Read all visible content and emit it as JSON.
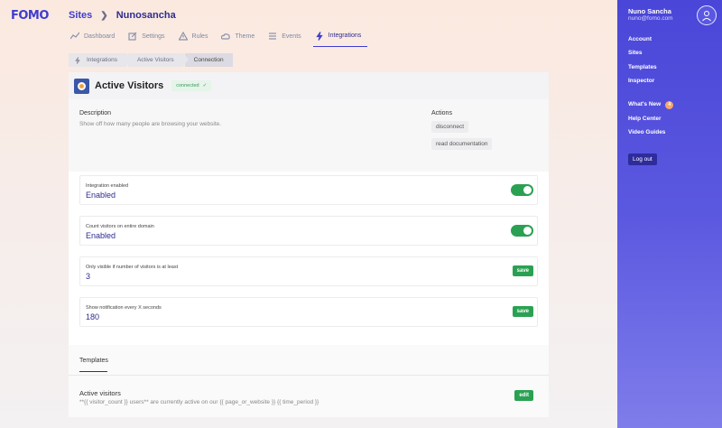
{
  "brand": {
    "logo": "FOMO"
  },
  "header": {
    "breadcrumb": [
      "Sites",
      "Nunosancha"
    ],
    "tabs": [
      {
        "label": "Dashboard",
        "icon": "chart-line-icon"
      },
      {
        "label": "Settings",
        "icon": "edit-icon"
      },
      {
        "label": "Rules",
        "icon": "warning-icon"
      },
      {
        "label": "Theme",
        "icon": "cloud-icon"
      },
      {
        "label": "Events",
        "icon": "list-icon"
      },
      {
        "label": "Integrations",
        "icon": "bolt-icon",
        "active": true
      }
    ]
  },
  "steps": [
    "Integrations",
    "Active Visitors",
    "Connection"
  ],
  "card": {
    "title": "Active Visitors",
    "status": "connected",
    "description_label": "Description",
    "description": "Show off how many people are browsing your website.",
    "actions_label": "Actions",
    "actions": [
      "disconnect",
      "read documentation"
    ]
  },
  "fields": [
    {
      "label": "Integration enabled",
      "value": "Enabled",
      "control": "toggle"
    },
    {
      "label": "Count visitors on entire domain",
      "value": "Enabled",
      "control": "toggle"
    },
    {
      "label": "Only visible if number of visitors is at least",
      "value": "3",
      "control": "save"
    },
    {
      "label": "Show notification every X seconds",
      "value": "180",
      "control": "save"
    }
  ],
  "buttons": {
    "save": "save",
    "edit": "edit"
  },
  "templates": {
    "tab": "Templates",
    "name": "Active visitors",
    "text": "**{{ visitor_count }} users** are currently active on our {{ page_or_website }} {{ time_period }}"
  },
  "sidebar": {
    "user_name": "Nuno Sancha",
    "user_email": "nuno@fomo.com",
    "links_1": [
      "Account",
      "Sites",
      "Templates",
      "Inspector"
    ],
    "whats_new": "What's New",
    "whats_new_count": "4",
    "links_2": [
      "Help Center",
      "Video Guides"
    ],
    "logout": "Log out"
  },
  "colors": {
    "accent": "#3f3ccf",
    "success": "#2aa152",
    "sidebar": "#4a46d8"
  }
}
